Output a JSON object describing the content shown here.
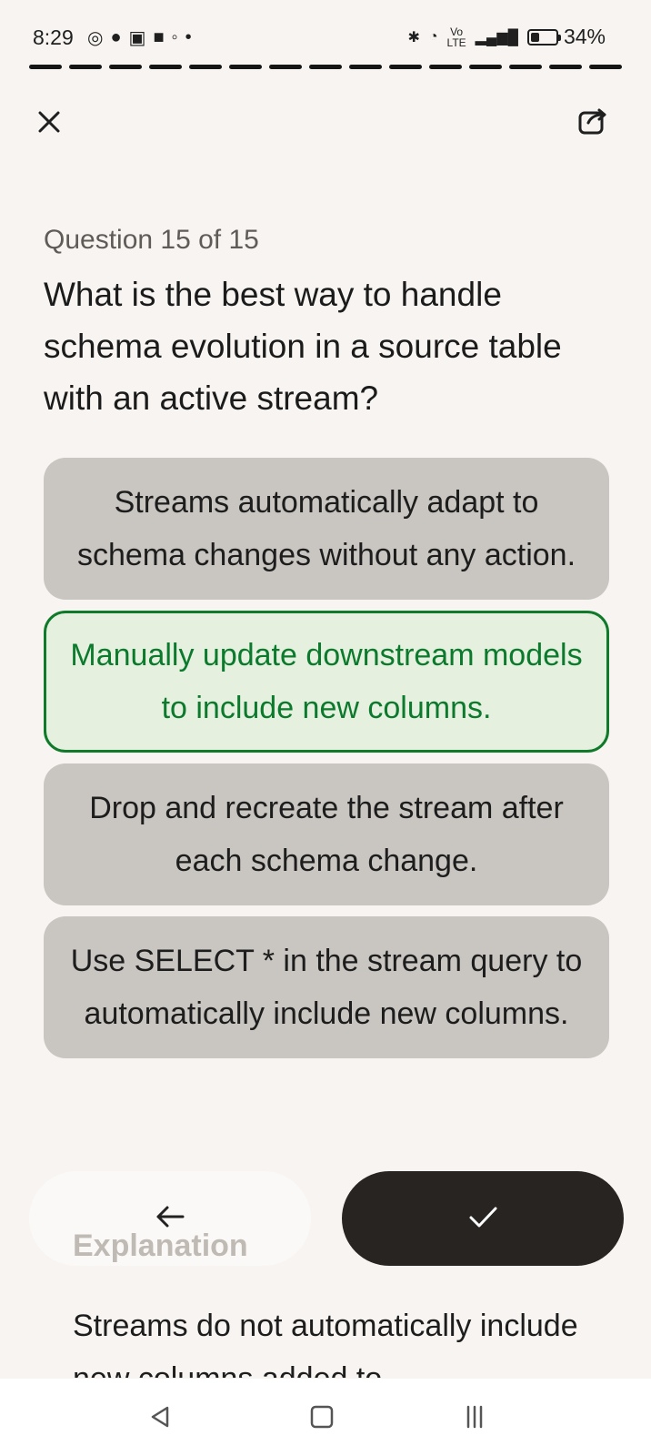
{
  "status_bar": {
    "time": "8:29",
    "battery_percent": "34%",
    "battery_level": 0.34,
    "network_label_top": "Vo",
    "network_label_bottom": "LTE"
  },
  "progress": {
    "total_segments": 15,
    "completed_segments": 15
  },
  "quiz": {
    "counter": "Question 15 of 15",
    "question": "What is the best way to handle schema evolution in a source table with an active stream?",
    "options": [
      {
        "label": "Streams automatically adapt to schema changes without any action."
      },
      {
        "label": "Manually update downstream models to include new columns.",
        "selected": true
      },
      {
        "label": "Drop and recreate the stream after each schema change."
      },
      {
        "label": "Use SELECT * in the stream query to automatically include new columns."
      }
    ]
  },
  "actions": {
    "back_icon": "back-arrow-icon",
    "submit_icon": "checkmark-icon"
  },
  "explanation": {
    "title": "Explanation",
    "text": "Streams do not automatically include new columns added to"
  },
  "colors": {
    "background": "#f7f4f1",
    "option_bg": "#c9c5c1",
    "selected_bg": "#e5f0df",
    "selected_border": "#0f7a2a",
    "submit_bg": "#272422"
  }
}
